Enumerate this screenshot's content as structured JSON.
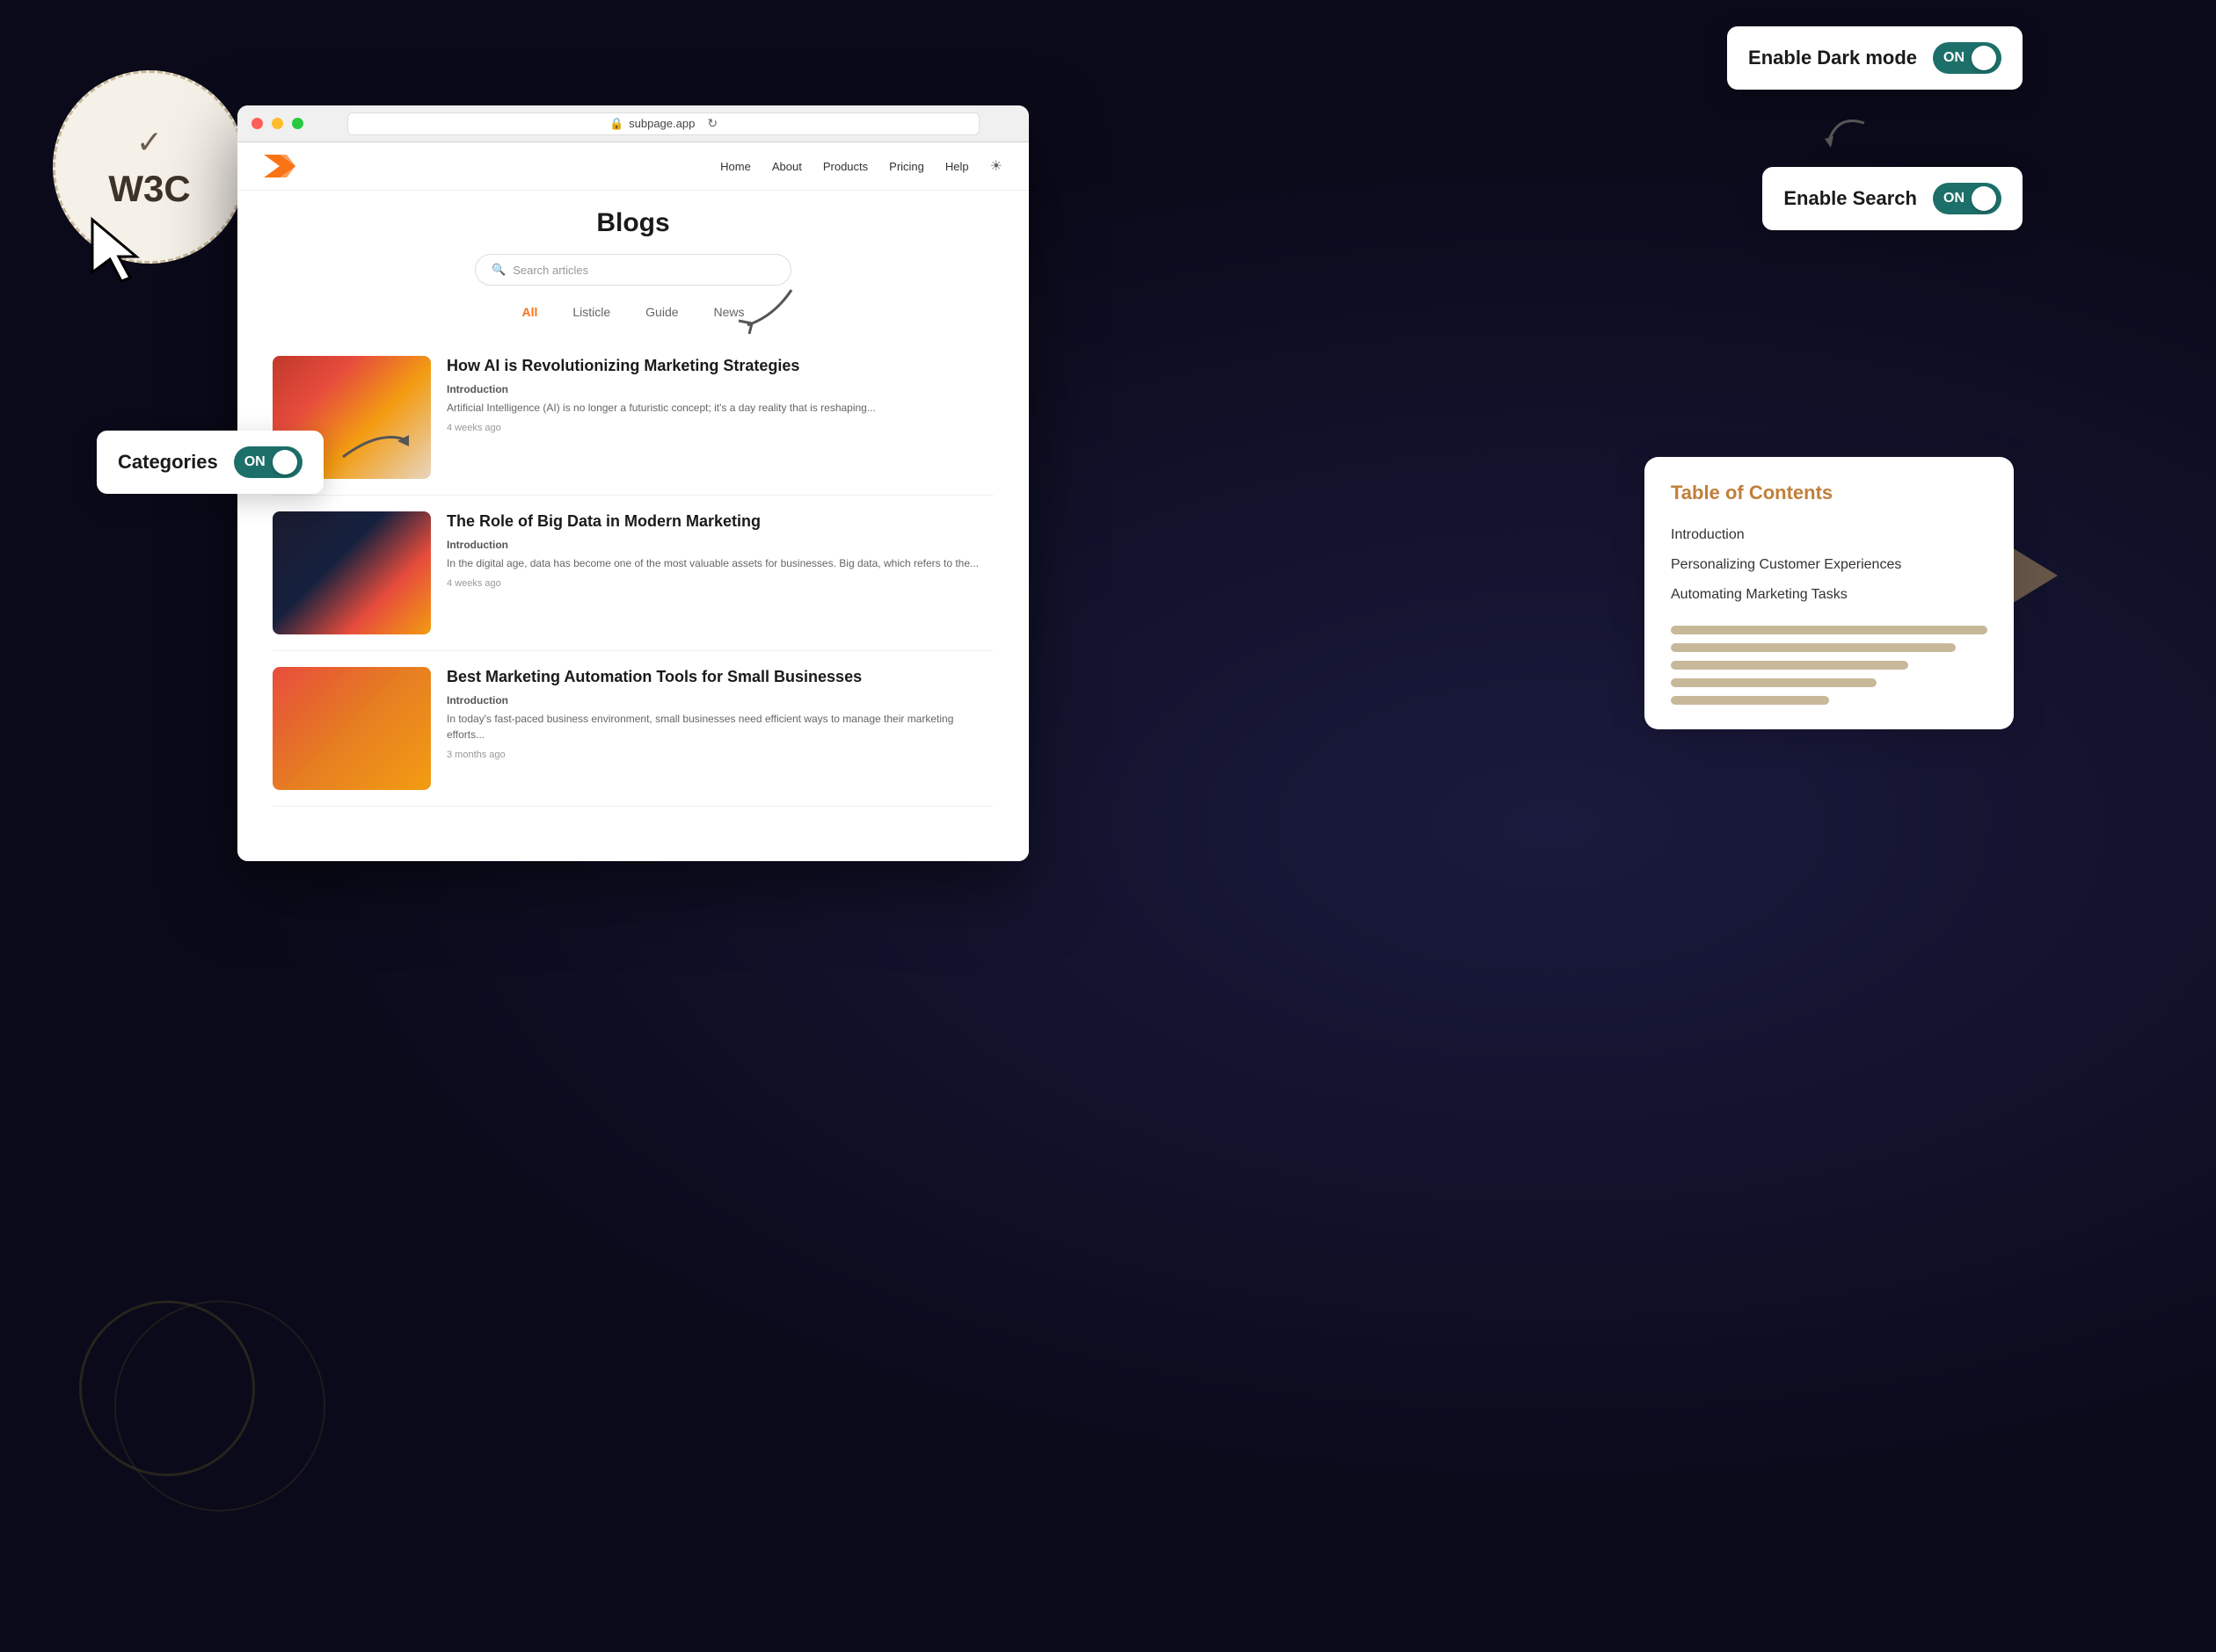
{
  "background": {
    "color": "#0a0a1a"
  },
  "w3c_badge": {
    "check_icon": "✓",
    "label": "W3C"
  },
  "browser": {
    "url": "subpage.app",
    "lock_icon": "🔒",
    "dots": [
      "red",
      "yellow",
      "green"
    ]
  },
  "website": {
    "nav": {
      "links": [
        "Home",
        "About",
        "Products",
        "Pricing",
        "Help"
      ]
    },
    "page_title": "Blogs",
    "search": {
      "placeholder": "Search articles"
    },
    "categories": {
      "tabs": [
        {
          "label": "All",
          "active": true
        },
        {
          "label": "Listicle",
          "active": false
        },
        {
          "label": "Guide",
          "active": false
        },
        {
          "label": "News",
          "active": false
        }
      ]
    },
    "articles": [
      {
        "title": "How AI is Revolutionizing Marketing Strategies",
        "section": "Introduction",
        "excerpt": "Artificial Intelligence (AI) is no longer a futuristic concept; it's a day reality that is reshaping...",
        "date": "4 weeks ago",
        "thumb_type": "robot"
      },
      {
        "title": "The Role of Big Data in Modern Marketing",
        "section": "Introduction",
        "excerpt": "In the digital age, data has become one of the most valuable assets for businesses. Big data, which refers to the...",
        "date": "4 weeks ago",
        "thumb_type": "data"
      },
      {
        "title": "Best Marketing Automation Tools for Small Businesses",
        "section": "Introduction",
        "excerpt": "In today's fast-paced business environment, small businesses need efficient ways to manage their marketing efforts...",
        "date": "3 months ago",
        "thumb_type": "tools"
      }
    ]
  },
  "tooltips": {
    "dark_mode": {
      "label": "Enable Dark mode",
      "toggle_state": "ON"
    },
    "search": {
      "label": "Enable Search",
      "toggle_state": "ON"
    },
    "categories": {
      "label": "Categories",
      "toggle_state": "ON"
    }
  },
  "toc": {
    "title": "Table of Contents",
    "items": [
      "Introduction",
      "Personalizing Customer Experiences",
      "Automating Marketing Tasks"
    ],
    "bars": [
      100,
      90,
      75,
      65,
      50
    ]
  }
}
